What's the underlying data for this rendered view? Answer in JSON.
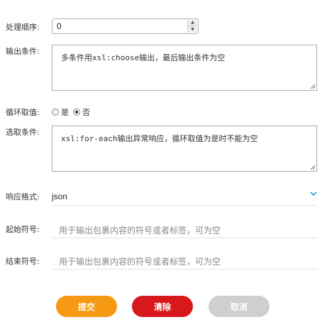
{
  "form": {
    "order": {
      "label": "处理顺序:",
      "value": "0"
    },
    "output_condition": {
      "label": "输出条件:",
      "value": "多条件用xsl:choose输出，最后输出条件为空"
    },
    "loop": {
      "label": "循环取值:",
      "options": [
        "是",
        "否"
      ],
      "selected": "否"
    },
    "select_condition": {
      "label": "选取条件:",
      "value": "xsl:for-each输出异常响应，循环取值为是时不能为空"
    },
    "response_format": {
      "label": "响应格式:",
      "value": "json"
    },
    "start_symbol": {
      "label": "起始符号:",
      "placeholder": "用于输出包裹内容的符号或者标签，可为空"
    },
    "end_symbol": {
      "label": "结束符号:",
      "placeholder": "用于输出包裹内容的符号或者标签，可为空"
    }
  },
  "buttons": {
    "submit": "提交",
    "clear": "清除",
    "cancel": "取消"
  },
  "colors": {
    "submit": "#f59a12",
    "clear": "#d7191c",
    "cancel": "#cfcfcf",
    "chevron": "#2a9bd6"
  }
}
